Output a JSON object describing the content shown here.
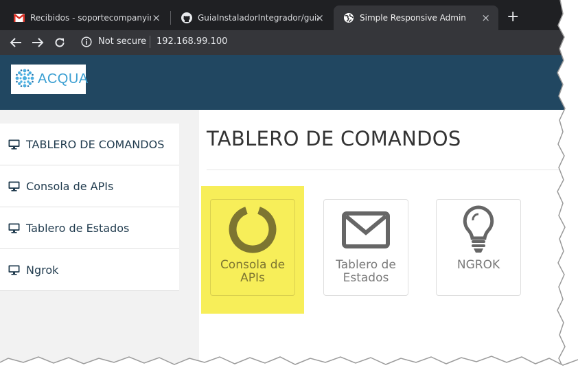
{
  "browser": {
    "tabs": [
      {
        "title": "Recibidos - soportecompanyinteg",
        "icon": "gmail-icon"
      },
      {
        "title": "GuiaInstaladorIntegrador/guia_in",
        "icon": "github-icon"
      },
      {
        "title": "Simple Responsive Admin",
        "icon": "globe-icon",
        "active": true
      }
    ],
    "close_glyph": "×",
    "newtab_glyph": "+",
    "security": "Not secure",
    "url": "192.168.99.100"
  },
  "header": {
    "logo_text": "ACQUA",
    "background": "#214761"
  },
  "sidebar": {
    "items": [
      {
        "label": "TABLERO DE COMANDOS",
        "icon": "monitor-icon"
      },
      {
        "label": "Consola de APIs",
        "icon": "monitor-icon"
      },
      {
        "label": "Tablero de Estados",
        "icon": "monitor-icon"
      },
      {
        "label": "Ngrok",
        "icon": "monitor-icon"
      }
    ]
  },
  "main": {
    "title": "TABLERO DE COMANDOS",
    "tiles": [
      {
        "label_line1": "Consola de",
        "label_line2": "APIs",
        "icon": "circle-notch-icon",
        "highlighted": true
      },
      {
        "label_line1": "Tablero de",
        "label_line2": "Estados",
        "icon": "envelope-icon"
      },
      {
        "label_line1": "NGROK",
        "label_line2": "",
        "icon": "lightbulb-icon"
      }
    ]
  },
  "colors": {
    "highlight": "#f7ee59",
    "tile_icon": "#666666",
    "highlighted_icon": "#7d7531"
  }
}
